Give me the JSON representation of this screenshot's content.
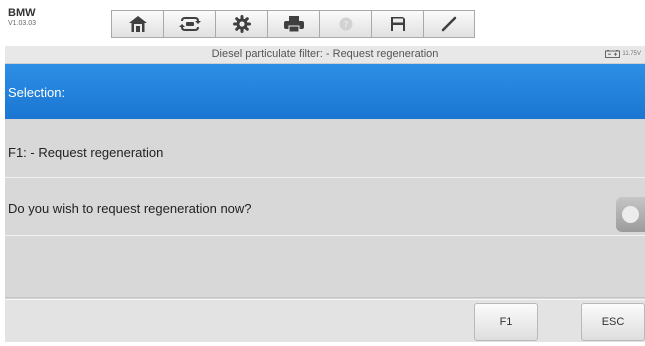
{
  "header": {
    "brand": "BMW",
    "version": "V1.03.03",
    "toolbar": [
      {
        "icon": "home-icon"
      },
      {
        "icon": "vehicle-swap-icon"
      },
      {
        "icon": "gear-icon"
      },
      {
        "icon": "printer-icon"
      },
      {
        "icon": "help-icon",
        "disabled": true
      },
      {
        "icon": "save-icon"
      },
      {
        "icon": "pen-icon"
      }
    ]
  },
  "status": {
    "title": "Diesel particulate filter: - Request regeneration",
    "battery_voltage": "11.75V"
  },
  "content": {
    "selection_label": "Selection:",
    "function_item": "F1: - Request regeneration",
    "question": "Do you wish to request regeneration now?"
  },
  "actions": {
    "f1_label": "F1",
    "esc_label": "ESC"
  },
  "colors": {
    "selection_bar": "#1e7fdc",
    "row_background": "#d8d8d8"
  }
}
